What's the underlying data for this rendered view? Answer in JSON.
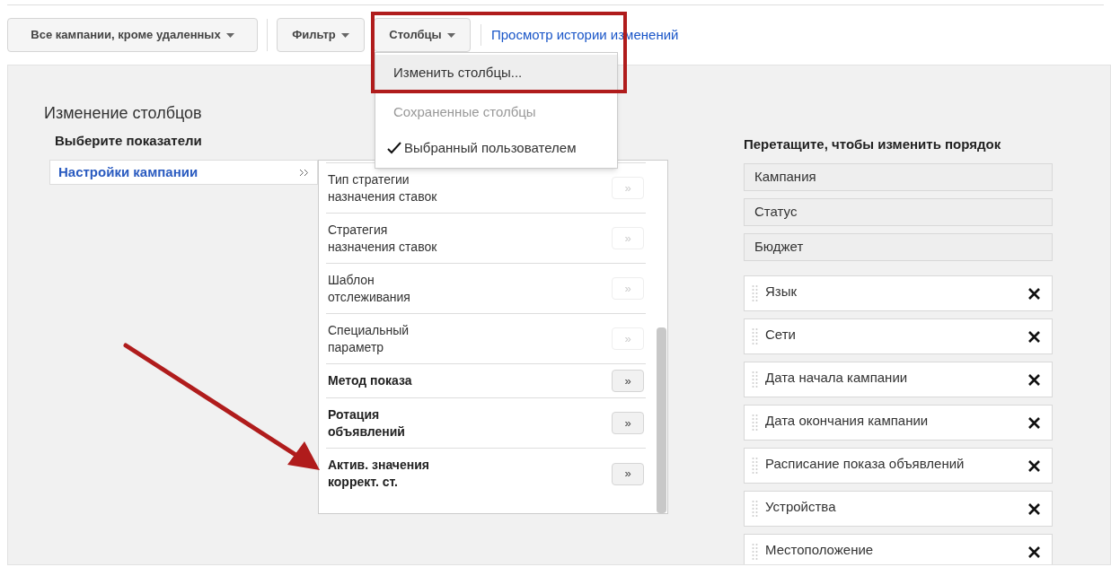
{
  "toolbar": {
    "campaign_filter": "Все кампании, кроме удаленных",
    "filter": "Фильтр",
    "columns": "Столбцы",
    "history_link": "Просмотр истории изменений"
  },
  "columns_menu": [
    {
      "label": "Изменить столбцы...",
      "selected": true,
      "disabled": false,
      "checked": false
    },
    {
      "label": "Сохраненные столбцы",
      "selected": false,
      "disabled": true,
      "checked": false
    },
    {
      "label": "Выбранный пользователем",
      "selected": false,
      "disabled": false,
      "checked": true
    }
  ],
  "panel": {
    "title": "Изменение столбцов",
    "choose_heading": "Выберите показатели",
    "order_heading": "Перетащите, чтобы изменить порядок"
  },
  "categories": [
    {
      "label": "Настройки кампании",
      "selected": true
    }
  ],
  "metrics": [
    {
      "label": "Тип стратегии\nназначения ставок",
      "button": "»",
      "disabled": true
    },
    {
      "label": "Стратегия\nназначения ставок",
      "button": "»",
      "disabled": true
    },
    {
      "label": "Шаблон\nотслеживания",
      "button": "»",
      "disabled": true
    },
    {
      "label": "Специальный\nпараметр",
      "button": "»",
      "disabled": true
    },
    {
      "label": "Метод показа",
      "button": "»",
      "disabled": false
    },
    {
      "label": "Ротация\nобъявлений",
      "button": "»",
      "disabled": false
    },
    {
      "label": "Актив. значения\nкоррект. ст.",
      "button": "»",
      "disabled": false
    }
  ],
  "selected_columns": [
    {
      "label": "Кампания",
      "kind": "fixed"
    },
    {
      "label": "Статус",
      "kind": "fixed"
    },
    {
      "label": "Бюджет",
      "kind": "fixed"
    },
    {
      "label": "Язык",
      "kind": "removable"
    },
    {
      "label": "Сети",
      "kind": "removable"
    },
    {
      "label": "Дата начала кампании",
      "kind": "removable"
    },
    {
      "label": "Дата окончания кампании",
      "kind": "removable"
    },
    {
      "label": "Расписание показа объявлений",
      "kind": "removable"
    },
    {
      "label": "Устройства",
      "kind": "removable"
    },
    {
      "label": "Местоположение",
      "kind": "removable"
    }
  ]
}
